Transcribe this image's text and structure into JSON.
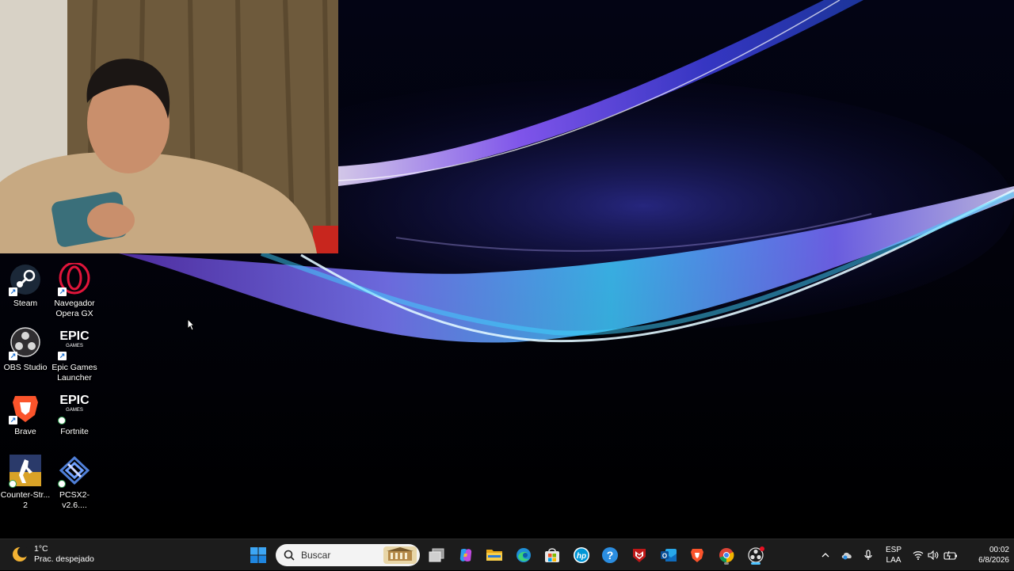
{
  "desktop": {
    "icons": [
      {
        "label": "Steam"
      },
      {
        "label": "Navegador Opera GX"
      },
      {
        "label": "OBS Studio"
      },
      {
        "label": "Epic Games Launcher"
      },
      {
        "label": "Brave"
      },
      {
        "label": "Fortnite"
      },
      {
        "label": "Counter-Str... 2"
      },
      {
        "label": "PCSX2-v2.6...."
      }
    ],
    "epic_logo_text": "EPIC",
    "epic_logo_sub": "GAMES"
  },
  "taskbar": {
    "weather": {
      "temp": "1°C",
      "condition": "Prac. despejado"
    },
    "search": {
      "placeholder": "Buscar"
    },
    "apps": [
      "start-icon",
      "task-view-icon",
      "copilot-icon",
      "file-explorer-icon",
      "edge-icon",
      "microsoft-store-icon",
      "hp-icon",
      "help-icon",
      "mcafee-icon",
      "outlook-icon",
      "brave-icon",
      "chrome-icon",
      "obs-icon"
    ],
    "tray": {
      "lang_line1": "ESP",
      "lang_line2": "LAA",
      "time": "00:02",
      "date": "6/8/2026"
    }
  },
  "colors": {
    "taskbar_bg": "#1c1c1c",
    "wallpaper_bg": "#000000",
    "accent_cyan": "#2fd6ff",
    "accent_purple": "#8c5cff"
  }
}
